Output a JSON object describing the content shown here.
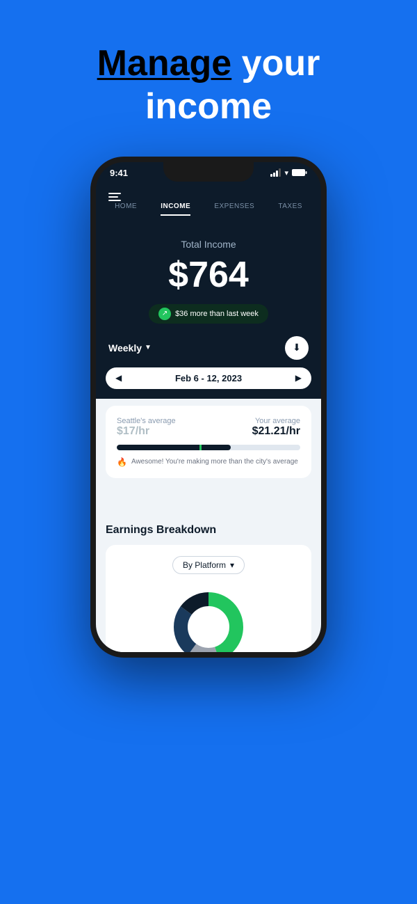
{
  "hero": {
    "title_prefix": "Manage",
    "title_suffix": " your",
    "title_line2": "income"
  },
  "status_bar": {
    "time": "9:41"
  },
  "nav": {
    "tabs": [
      {
        "label": "HOME",
        "active": false
      },
      {
        "label": "INCOME",
        "active": true
      },
      {
        "label": "EXPENSES",
        "active": false
      },
      {
        "label": "TAXES",
        "active": false
      }
    ]
  },
  "income": {
    "label": "Total Income",
    "amount": "$764",
    "badge": "$36 more than last week"
  },
  "weekly": {
    "label": "Weekly",
    "date_range": "Feb 6 - 12, 2023"
  },
  "average": {
    "city_label": "Seattle's average",
    "city_value": "$17/hr",
    "your_label": "Your average",
    "your_value": "$21.21/hr",
    "tip": "Awesome! You're making more than the city's average"
  },
  "earnings": {
    "title": "Earnings Breakdown",
    "platform_selector": "By Platform"
  },
  "donut": {
    "segments": [
      {
        "color": "#22c55e",
        "value": 45
      },
      {
        "color": "#9ca3af",
        "value": 15
      },
      {
        "color": "#0d1b2a",
        "value": 25
      },
      {
        "color": "#1a1a2e",
        "value": 15
      }
    ]
  }
}
